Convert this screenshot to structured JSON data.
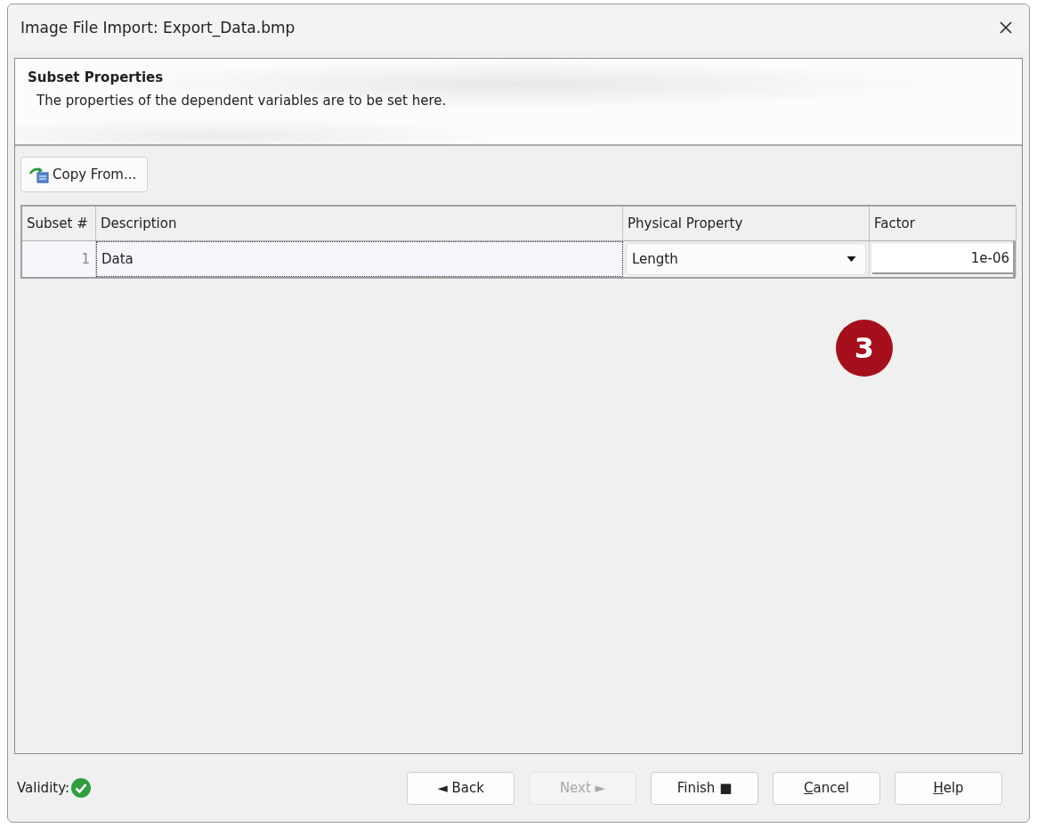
{
  "window": {
    "title": "Image File Import: Export_Data.bmp"
  },
  "header": {
    "title": "Subset Properties",
    "subtitle": "The properties of the dependent variables are to be set here."
  },
  "toolbar": {
    "copy_button": "Copy From..."
  },
  "table": {
    "columns": [
      "Subset #",
      "Description",
      "Physical Property",
      "Factor"
    ],
    "rows": [
      {
        "number": "1",
        "description": "Data",
        "property": "Length",
        "factor": "1e-06",
        "selected": true
      }
    ]
  },
  "callout": {
    "label": "3"
  },
  "footer": {
    "validity_label": "Validity:",
    "valid": true,
    "buttons": [
      {
        "label": "◄ Back",
        "disabled": false,
        "underline_first": false
      },
      {
        "label": "Next ►",
        "disabled": true,
        "underline_first": false
      },
      {
        "label": "Finish ■",
        "disabled": false,
        "underline_first": false
      },
      {
        "label": "Cancel",
        "disabled": false,
        "underline_first": true
      },
      {
        "label": "Help",
        "disabled": false,
        "underline_first": true
      }
    ]
  }
}
